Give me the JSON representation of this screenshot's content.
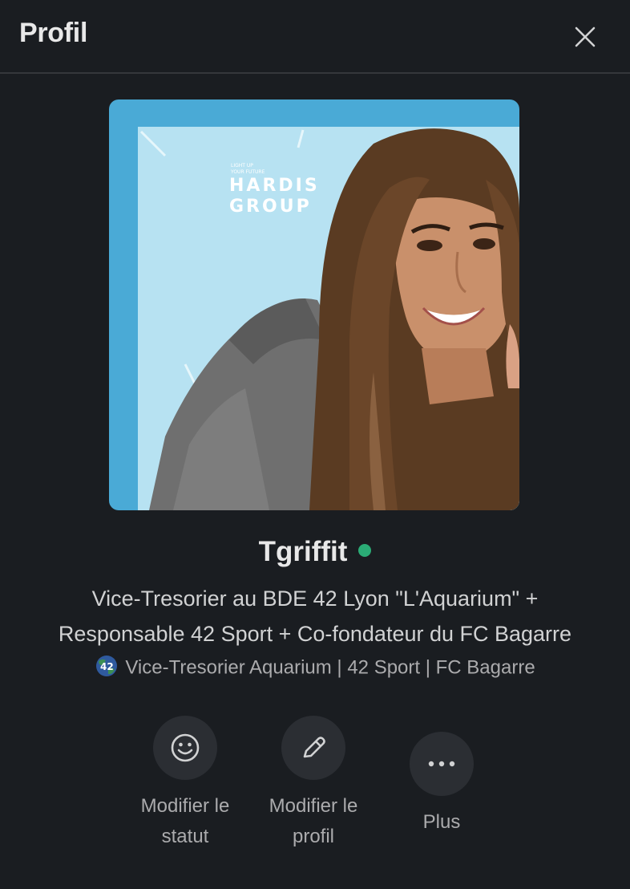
{
  "header": {
    "title": "Profil",
    "close_icon": "close-icon"
  },
  "profile": {
    "display_name": "Tgriffit",
    "presence": "active",
    "presence_color": "#2bac76",
    "title_line1": "Vice-Tresorier au BDE 42 Lyon \"L'Aquarium\" +",
    "title_line2": "Responsable 42 Sport + Co-fondateur du FC Bagarre",
    "status_emoji": "globe-42-icon",
    "status_text": "Vice-Tresorier Aquarium | 42 Sport | FC Bagarre",
    "photo_backdrop_text_small1": "LIGHT UP",
    "photo_backdrop_text_small2": "YOUR FUTURE",
    "photo_backdrop_text_big1": "HARDIS",
    "photo_backdrop_text_big2": "GROUP"
  },
  "actions": [
    {
      "icon": "smiley-icon",
      "label_line1": "Modifier le",
      "label_line2": "statut"
    },
    {
      "icon": "pencil-icon",
      "label_line1": "Modifier le",
      "label_line2": "profil"
    },
    {
      "icon": "more-horizontal-icon",
      "label_line1": "Plus",
      "label_line2": ""
    }
  ],
  "colors": {
    "background": "#1a1d21",
    "divider": "#35373b",
    "button_bg": "#2b2e33"
  }
}
